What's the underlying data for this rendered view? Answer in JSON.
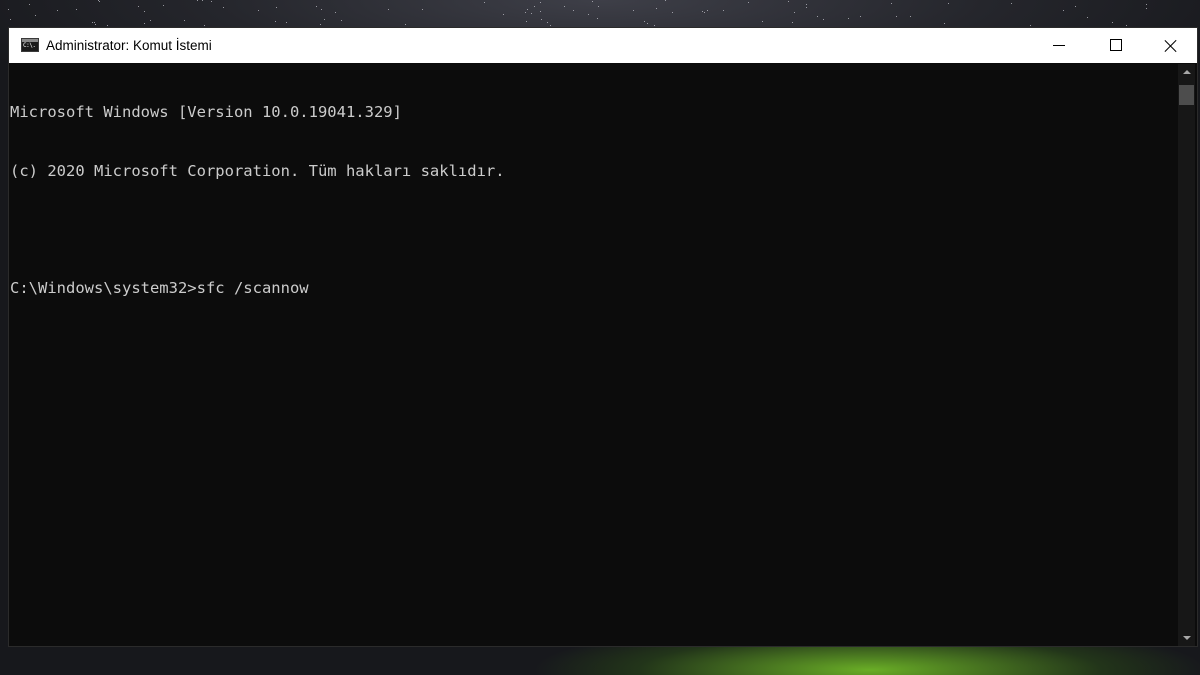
{
  "window": {
    "title": "Administrator: Komut İstemi",
    "icon_label": "C:\\."
  },
  "icons": {
    "app": "command-prompt-icon",
    "minimize": "minimize-icon",
    "maximize": "maximize-icon",
    "close": "close-icon",
    "scroll_up": "chevron-up-icon",
    "scroll_down": "chevron-down-icon"
  },
  "console": {
    "lines": [
      "Microsoft Windows [Version 10.0.19041.329]",
      "(c) 2020 Microsoft Corporation. Tüm hakları saklıdır.",
      "",
      "C:\\Windows\\system32>sfc /scannow"
    ]
  },
  "colors": {
    "console_background": "#0c0c0c",
    "console_text": "#cccccc",
    "titlebar_background": "#ffffff"
  }
}
